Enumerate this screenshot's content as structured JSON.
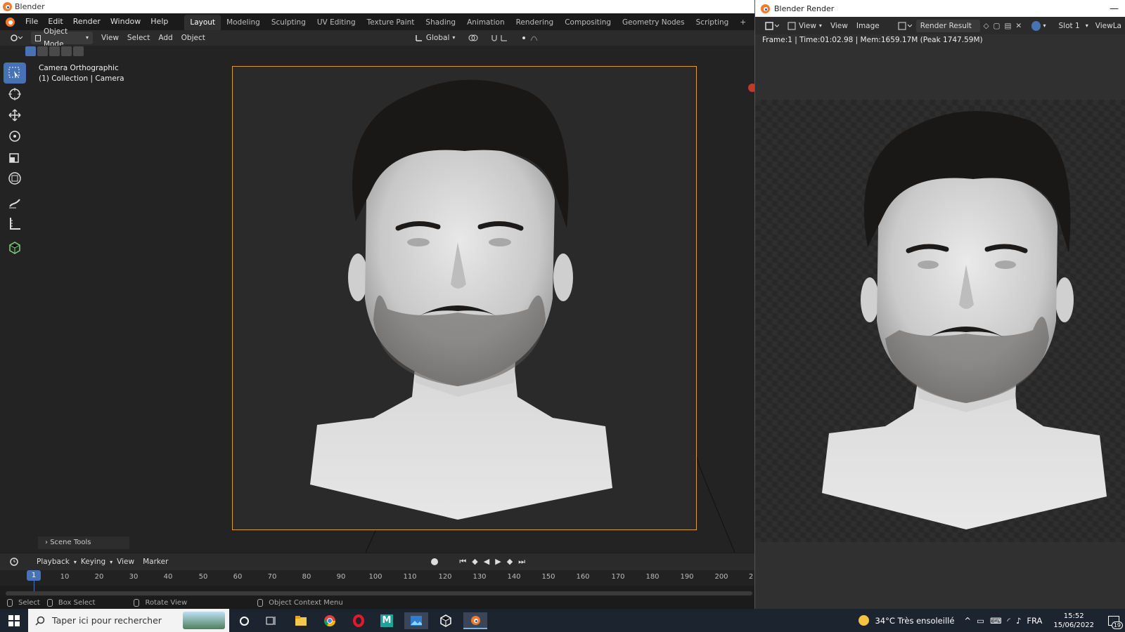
{
  "main_window": {
    "title": "Blender",
    "menus": [
      "File",
      "Edit",
      "Render",
      "Window",
      "Help"
    ],
    "workspaces": [
      "Layout",
      "Modeling",
      "Sculpting",
      "UV Editing",
      "Texture Paint",
      "Shading",
      "Animation",
      "Rendering",
      "Compositing",
      "Geometry Nodes",
      "Scripting"
    ],
    "active_workspace": "Layout",
    "add_workspace": "+"
  },
  "viewport_header": {
    "mode": "Object Mode",
    "menus": [
      "View",
      "Select",
      "Add",
      "Object"
    ],
    "orientation": "Global"
  },
  "viewport": {
    "camera_info_line1": "Camera Orthographic",
    "camera_info_line2": "(1) Collection | Camera",
    "scene_tools_label": "Scene Tools",
    "tools": [
      "select-box-icon",
      "cursor-icon",
      "move-icon",
      "rotate-icon",
      "scale-icon",
      "transform-icon",
      "annotate-icon",
      "measure-icon",
      "add-cube-icon"
    ]
  },
  "timeline": {
    "menus": [
      "Playback",
      "Keying",
      "View",
      "Marker"
    ],
    "current_frame": "1",
    "ticks": [
      "10",
      "20",
      "30",
      "40",
      "50",
      "60",
      "70",
      "80",
      "90",
      "100",
      "110",
      "120",
      "130",
      "140",
      "150",
      "160",
      "170",
      "180",
      "190",
      "200",
      "2"
    ]
  },
  "statusbar": {
    "select": "Select",
    "box_select": "Box Select",
    "rotate_view": "Rotate View",
    "context_menu": "Object Context Menu"
  },
  "render_window": {
    "title": "Blender Render",
    "menus": [
      "View",
      "View",
      "Image"
    ],
    "image_name": "Render Result",
    "slot": "Slot 1",
    "view_layer": "ViewLa",
    "info": "Frame:1 | Time:01:02.98 | Mem:1659.17M (Peak 1747.59M)"
  },
  "taskbar": {
    "search_placeholder": "Taper ici pour rechercher",
    "weather": "34°C  Très ensoleillé",
    "language": "FRA",
    "time": "15:52",
    "date": "15/06/2022",
    "notification_count": "19"
  },
  "colors": {
    "accent": "#4772b3",
    "camera_frame": "#e09a3a",
    "blender_orange": "#f5792a"
  }
}
